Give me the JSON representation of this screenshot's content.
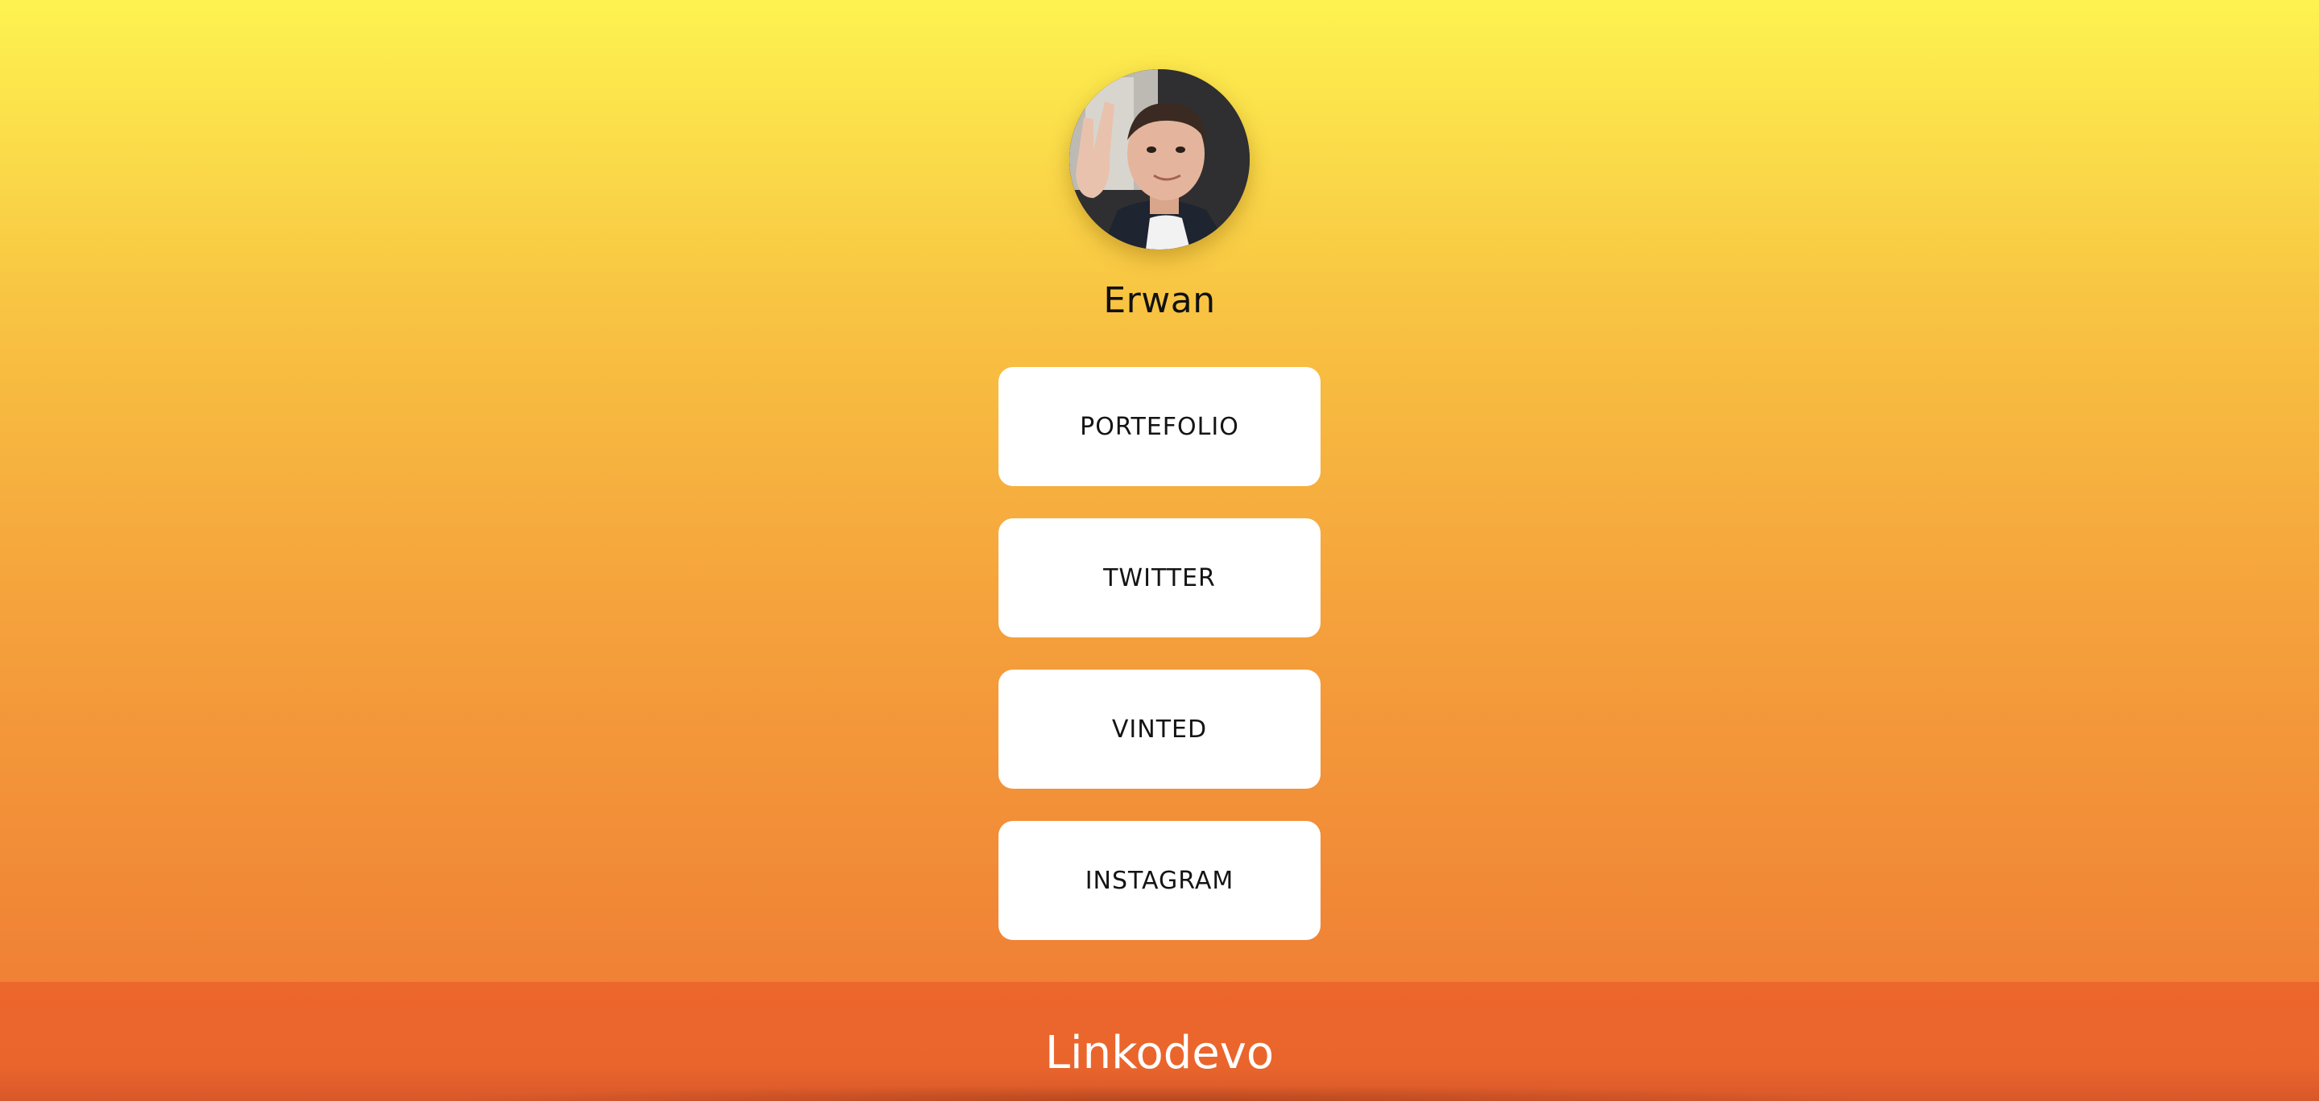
{
  "profile": {
    "name": "Erwan"
  },
  "links": [
    {
      "label": "PORTEFOLIO"
    },
    {
      "label": "TWITTER"
    },
    {
      "label": "VINTED"
    },
    {
      "label": "INSTAGRAM"
    }
  ],
  "footer": {
    "brand": "Linkodevo"
  },
  "colors": {
    "gradient_top": "#fdf350",
    "gradient_bottom": "#ee7731",
    "footer_bg": "#ea652c",
    "button_bg": "#ffffff",
    "text_dark": "#111111"
  }
}
